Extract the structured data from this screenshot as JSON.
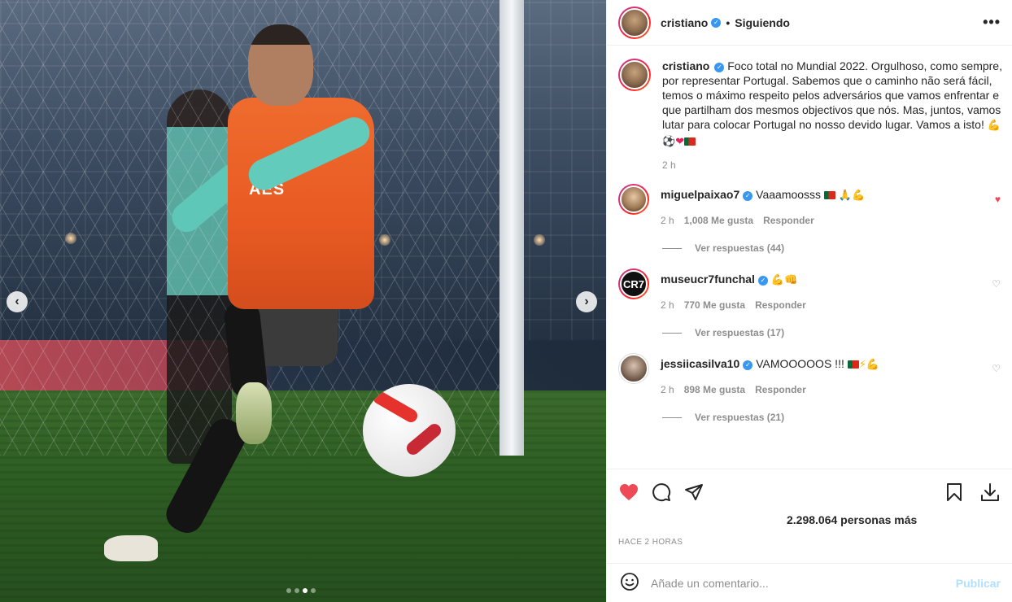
{
  "post": {
    "username": "cristiano",
    "following_label": "Siguiendo",
    "more_label": "•••",
    "caption": "Foco total no Mundial 2022. Orgulhoso, como sempre, por representar Portugal. Sabemos que o caminho não será fácil, temos o máximo respeito pelos adversários que vamos enfrentar e que partilham dos mesmos objectivos que nós. Mas, juntos, vamos lutar para colocar Portugal no nosso devido lugar. Vamos a isto!",
    "caption_time": "2 h",
    "likes_text": "2.298.064 personas más",
    "posted_ago": "HACE 2 HORAS",
    "image_vest_text": "AES",
    "carousel": {
      "slides": 4,
      "active_slide": 3
    }
  },
  "comments": [
    {
      "username": "miguelpaixao7",
      "text": "Vaaamoosss",
      "time": "2 h",
      "likes": "1,008 Me gusta",
      "reply_label": "Responder",
      "view_replies": "Ver respuestas (44)",
      "liked": true
    },
    {
      "username": "museucr7funchal",
      "avatar_text": "CR7",
      "text": "",
      "time": "2 h",
      "likes": "770 Me gusta",
      "reply_label": "Responder",
      "view_replies": "Ver respuestas (17)",
      "liked": false
    },
    {
      "username": "jessiicasilva10",
      "text": "VAMOOOOOS !!!",
      "time": "2 h",
      "likes": "898 Me gusta",
      "reply_label": "Responder",
      "view_replies": "Ver respuestas (21)",
      "liked": false
    }
  ],
  "comment_box": {
    "placeholder": "Añade un comentario...",
    "publish_label": "Publicar"
  },
  "icons": {
    "verified": "verified-badge-icon",
    "like": "heart-icon",
    "comment": "comment-icon",
    "share": "share-icon",
    "save": "bookmark-icon",
    "download": "download-icon",
    "emoji": "emoji-icon"
  },
  "colors": {
    "liked_heart": "#ed4956",
    "verified": "#3897f0",
    "publish_disabled": "#b2dffc"
  }
}
